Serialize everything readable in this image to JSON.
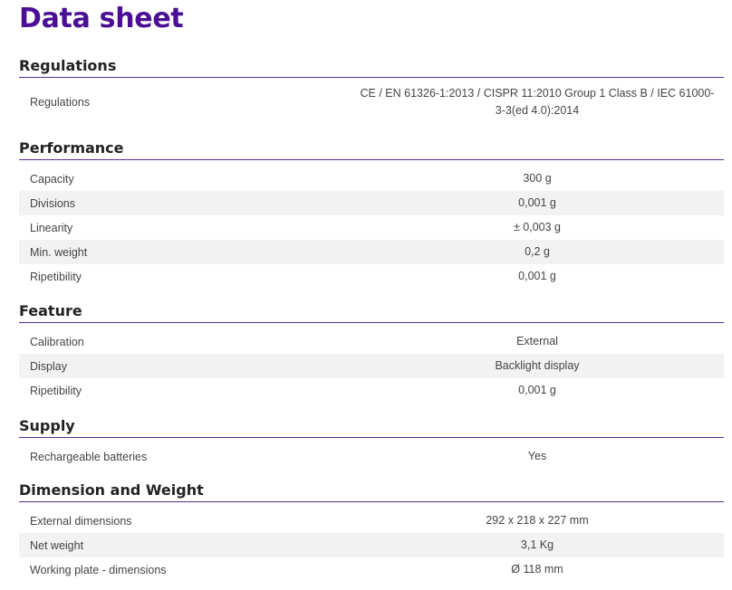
{
  "title": "Data sheet",
  "sections": [
    {
      "title": "Regulations",
      "rows": [
        {
          "label": "Regulations",
          "value": "CE / EN 61326-1:2013 / CISPR 11:2010 Group 1 Class B / IEC 61000-3-3(ed 4.0):2014"
        }
      ]
    },
    {
      "title": "Performance",
      "rows": [
        {
          "label": "Capacity",
          "value": "300 g"
        },
        {
          "label": "Divisions",
          "value": "0,001 g"
        },
        {
          "label": "Linearity",
          "value": "± 0,003 g"
        },
        {
          "label": "Min. weight",
          "value": "0,2 g"
        },
        {
          "label": "Ripetibility",
          "value": "0,001 g"
        }
      ]
    },
    {
      "title": "Feature",
      "rows": [
        {
          "label": "Calibration",
          "value": "External"
        },
        {
          "label": "Display",
          "value": "Backlight display"
        },
        {
          "label": "Ripetibility",
          "value": "0,001 g"
        }
      ]
    },
    {
      "title": "Supply",
      "rows": [
        {
          "label": "Rechargeable batteries",
          "value": "Yes"
        }
      ]
    },
    {
      "title": "Dimension and Weight",
      "rows": [
        {
          "label": "External dimensions",
          "value": "292 x 218 x 227 mm"
        },
        {
          "label": "Net weight",
          "value": "3,1 Kg"
        },
        {
          "label": "Working plate - dimensions",
          "value": "Ø 118 mm"
        }
      ]
    }
  ]
}
